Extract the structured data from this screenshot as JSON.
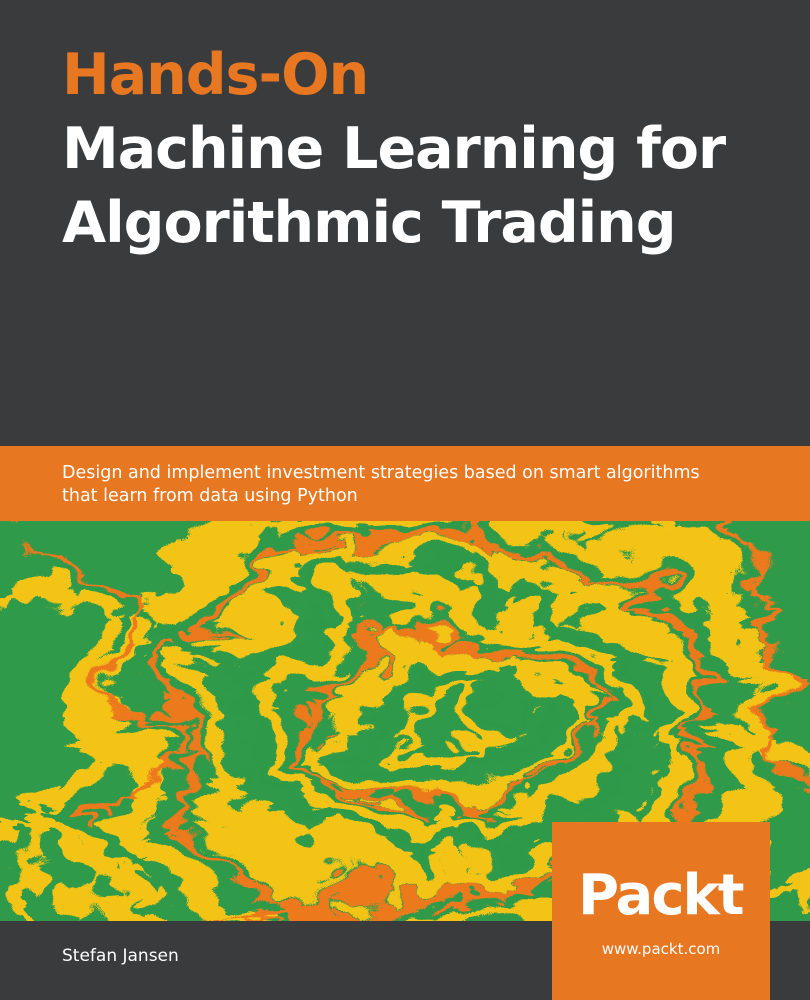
{
  "title": {
    "line1": "Hands-On",
    "line2": "Machine Learning for",
    "line3": "Algorithmic Trading"
  },
  "subtitle": {
    "line1": "Design and implement investment strategies based on smart algorithms",
    "line2": "that learn from data using Python"
  },
  "author": "Stefan Jansen",
  "publisher": {
    "logo": "Packt>",
    "url": "www.packt.com"
  },
  "colors": {
    "background": "#3a3b3d",
    "accent": "#e87722",
    "marble_green": "#2e9a4a",
    "marble_yellow": "#f3c318",
    "marble_orange": "#ec7a1e"
  }
}
